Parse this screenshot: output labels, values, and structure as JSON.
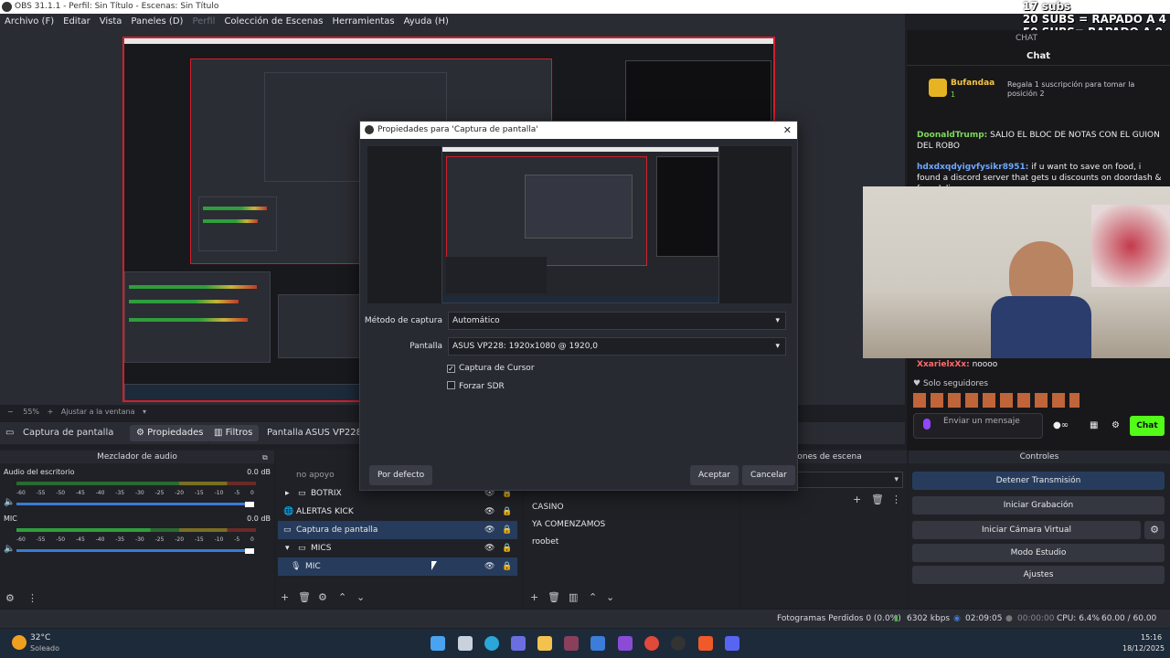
{
  "window": {
    "title": "OBS 31.1.1 - Perfil: Sin Título - Escenas: Sin Título"
  },
  "overlay": {
    "line1": "17 subs",
    "line2": "20 SUBS = RAPADO A 4",
    "line3": "50 SUBS= RAPADO A 0"
  },
  "menu": [
    "Archivo (F)",
    "Editar",
    "Vista",
    "Paneles (D)",
    "Perfil",
    "Colección de Escenas",
    "Herramientas",
    "Ayuda (H)"
  ],
  "preview": {
    "zoom": "55%",
    "fit": "Ajustar a la ventana"
  },
  "source_toolbar": {
    "source": "Captura de pantalla",
    "properties": "Propiedades",
    "filters": "Filtros",
    "screen_label": "Pantalla",
    "screen_value": "ASUS VP228: 19"
  },
  "mixer": {
    "title": "Mezclador de audio",
    "scale": [
      "-60",
      "-55",
      "-50",
      "-45",
      "-40",
      "-35",
      "-30",
      "-25",
      "-20",
      "-15",
      "-10",
      "-5",
      "0"
    ],
    "channels": [
      {
        "name": "Audio del escritorio",
        "db": "0.0 dB"
      },
      {
        "name": "MIC",
        "db": "0.0 dB"
      }
    ]
  },
  "sources": {
    "items": [
      {
        "name": "no apoyo"
      },
      {
        "name": "BOTRIX"
      },
      {
        "name": "ALERTAS KICK"
      },
      {
        "name": "Captura de pantalla"
      },
      {
        "name": "MICS"
      },
      {
        "name": "MIC"
      }
    ]
  },
  "scenes": {
    "title": "nciones de escena",
    "items": [
      "CASINO",
      "YA COMENZAMOS",
      "roobet"
    ]
  },
  "controls": {
    "title": "Controles",
    "buttons": [
      "Detener Transmisión",
      "Iniciar Grabación",
      "Iniciar Cámara Virtual",
      "Modo Estudio",
      "Ajustes"
    ]
  },
  "status": {
    "dropped": "Fotogramas Perdidos 0 (0.0%)",
    "bitrate": "6302 kbps",
    "stream_time": "02:09:05",
    "rec_time": "00:00:00",
    "cpu": "CPU: 6.4%",
    "fps": "60.00 / 60.00 FPS"
  },
  "chat": {
    "header": "CHAT",
    "title": "Chat",
    "gift_user": "Bufandaa",
    "gift_count": "1",
    "gift_text": "Regala 1 suscripción para tomar la posición 2",
    "messages": [
      {
        "user": "DoonaldTrump:",
        "text": "SALIO EL BLOC DE NOTAS CON EL GUION DEL ROBO",
        "color": "#7ed957"
      },
      {
        "user": "hdxdxqdyigvfysikr8951:",
        "text": "if u want to save on food, i found a discord server that gets u discounts on doordash & free delivery",
        "color": "#6ea8ff"
      },
      {
        "user": "XxarielxXx:",
        "text": "noooo",
        "color": "#ff6b6b"
      }
    ],
    "followers": "Solo seguidores",
    "input_placeholder": "Enviar un mensaje",
    "send": "Chat"
  },
  "dialog": {
    "title": "Propiedades para 'Captura de pantalla'",
    "method_label": "Método de captura",
    "method_value": "Automático",
    "screen_label": "Pantalla",
    "screen_value": "ASUS VP228: 1920x1080 @ 1920,0",
    "cursor": "Captura de Cursor",
    "sdr": "Forzar SDR",
    "default_btn": "Por defecto",
    "accept_btn": "Aceptar",
    "cancel_btn": "Cancelar"
  },
  "taskbar": {
    "temp": "32°C",
    "weather": "Soleado",
    "time": "15:16",
    "date": "18/12/2025"
  }
}
